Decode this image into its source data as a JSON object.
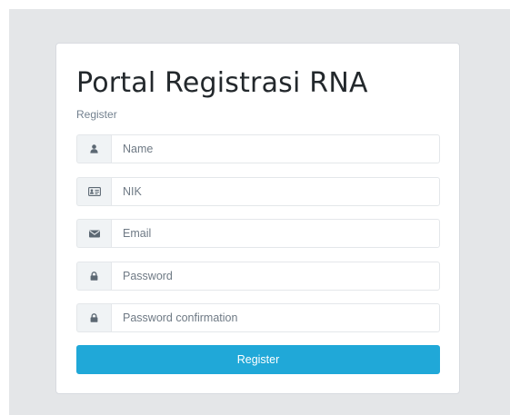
{
  "page": {
    "title": "Portal Registrasi RNA",
    "subtitle": "Register"
  },
  "form": {
    "fields": [
      {
        "name": "name",
        "icon": "user-icon",
        "placeholder": "Name",
        "value": ""
      },
      {
        "name": "nik",
        "icon": "id-card-icon",
        "placeholder": "NIK",
        "value": ""
      },
      {
        "name": "email",
        "icon": "envelope-icon",
        "placeholder": "Email",
        "value": ""
      },
      {
        "name": "password",
        "icon": "lock-icon",
        "placeholder": "Password",
        "value": ""
      },
      {
        "name": "password_confirmation",
        "icon": "lock-icon",
        "placeholder": "Password confirmation",
        "value": ""
      }
    ],
    "submit_label": "Register"
  },
  "colors": {
    "background": "#e4e6e8",
    "card": "#ffffff",
    "primary_button": "#20a8d8",
    "addon_background": "#f0f3f5",
    "icon": "#5c6873",
    "border": "#e4e7ea"
  }
}
